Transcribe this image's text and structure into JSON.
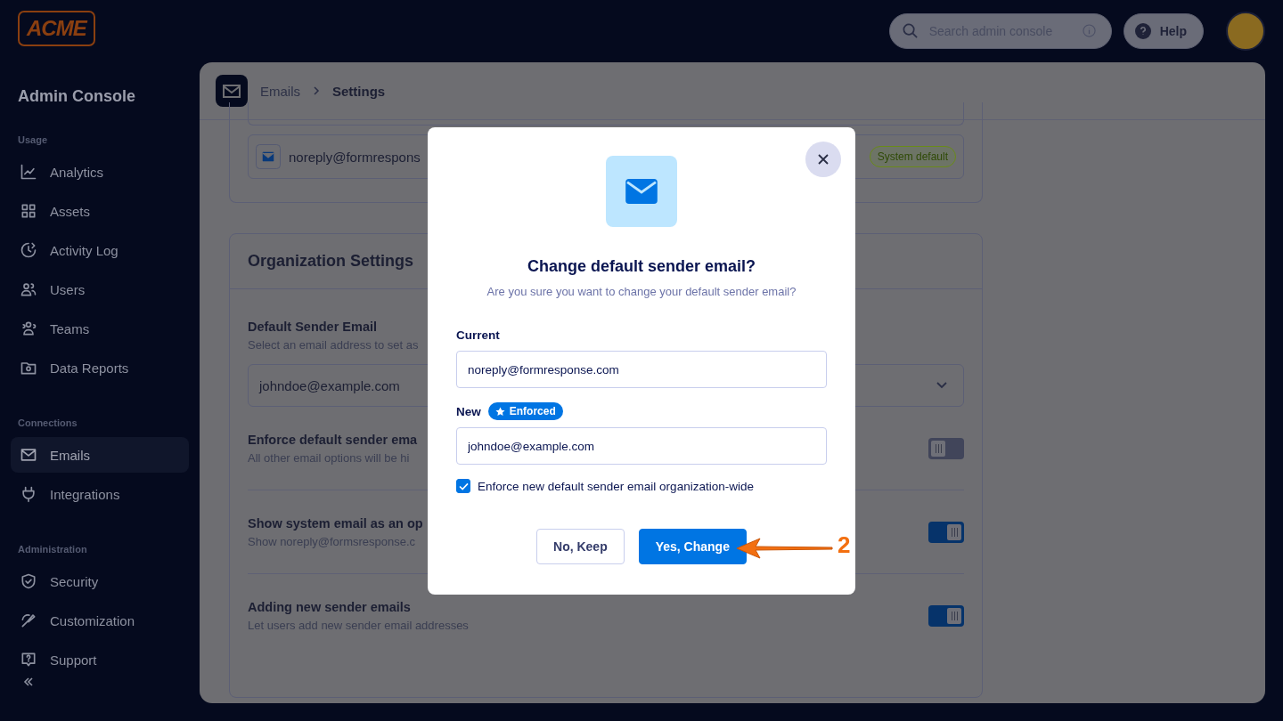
{
  "header": {
    "logo": "ACME",
    "search": {
      "placeholder": "Search admin console"
    },
    "help": "Help"
  },
  "sidebar": {
    "title": "Admin Console",
    "groups": [
      {
        "label": "Usage",
        "items": [
          {
            "label": "Analytics",
            "selected": false
          },
          {
            "label": "Assets",
            "selected": false
          },
          {
            "label": "Activity Log",
            "selected": false
          },
          {
            "label": "Users",
            "selected": false
          },
          {
            "label": "Teams",
            "selected": false
          },
          {
            "label": "Data Reports",
            "selected": false
          }
        ]
      },
      {
        "label": "Connections",
        "items": [
          {
            "label": "Emails",
            "selected": true
          },
          {
            "label": "Integrations",
            "selected": false
          }
        ]
      },
      {
        "label": "Administration",
        "items": [
          {
            "label": "Security",
            "selected": false
          },
          {
            "label": "Customization",
            "selected": false
          },
          {
            "label": "Support",
            "selected": false
          }
        ]
      }
    ]
  },
  "breadcrumb": [
    "Emails",
    "Settings"
  ],
  "sender_emails": [
    {
      "email": "noreply@formrespons",
      "badge": "System default"
    }
  ],
  "organization_settings": {
    "title": "Organization Settings",
    "default_sender": {
      "title": "Default Sender Email",
      "description": "Select an email address to set as",
      "value": "johndoe@example.com"
    },
    "toggles": [
      {
        "title": "Enforce default sender ema",
        "description": "All other email options will be hi",
        "on": false
      },
      {
        "title": "Show system email as an op",
        "description": "Show noreply@formsresponse.c",
        "on": true
      },
      {
        "title": "Adding new sender emails",
        "description": "Let users add new sender email addresses",
        "on": true
      }
    ]
  },
  "dialog": {
    "title": "Change default sender email?",
    "subtitle": "Are you sure you want to change your default sender email?",
    "current_label": "Current",
    "current_value": "noreply@formresponse.com",
    "new_label": "New",
    "new_badge": "Enforced",
    "new_value": "johndoe@example.com",
    "enforce": {
      "label": "Enforce new default sender email organization-wide",
      "checked": true
    },
    "buttons": [
      "No, Keep",
      "Yes, Change"
    ]
  },
  "annotation": {
    "label": "2"
  }
}
